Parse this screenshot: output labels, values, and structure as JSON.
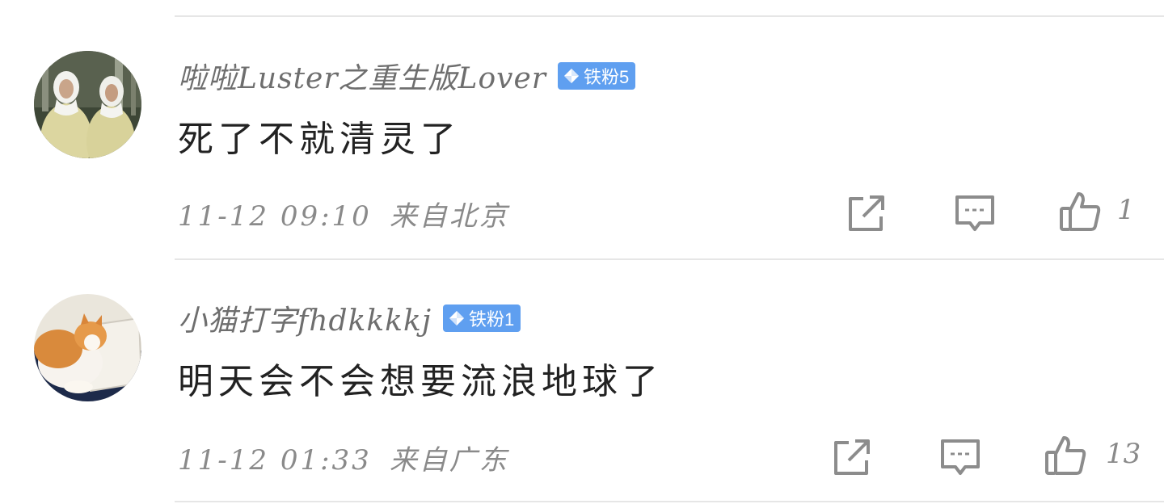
{
  "comments": [
    {
      "username": "啦啦Luster之重生版Lover",
      "badge": "铁粉5",
      "content": "死了不就清灵了",
      "time": "11-12 09:10",
      "location": "来自北京",
      "likes": "1",
      "avatar_icon": "avatar-photo-two-nuns"
    },
    {
      "username": "小猫打字fhdkkkkj",
      "badge": "铁粉1",
      "content": "明天会不会想要流浪地球了",
      "time": "11-12 01:33",
      "location": "来自广东",
      "likes": "13",
      "avatar_icon": "avatar-photo-cat"
    }
  ],
  "colors": {
    "badge": "#5f9ff0",
    "divider": "#e6e6e6",
    "meta_text": "#8a8a8a",
    "username_text": "#6e6e6e",
    "content_text": "#222222",
    "icon_stroke": "#8c8c8c"
  },
  "icons": {
    "share": "share-icon",
    "reply": "reply-icon",
    "like": "thumbs-up-icon",
    "badge": "diamond-icon"
  }
}
